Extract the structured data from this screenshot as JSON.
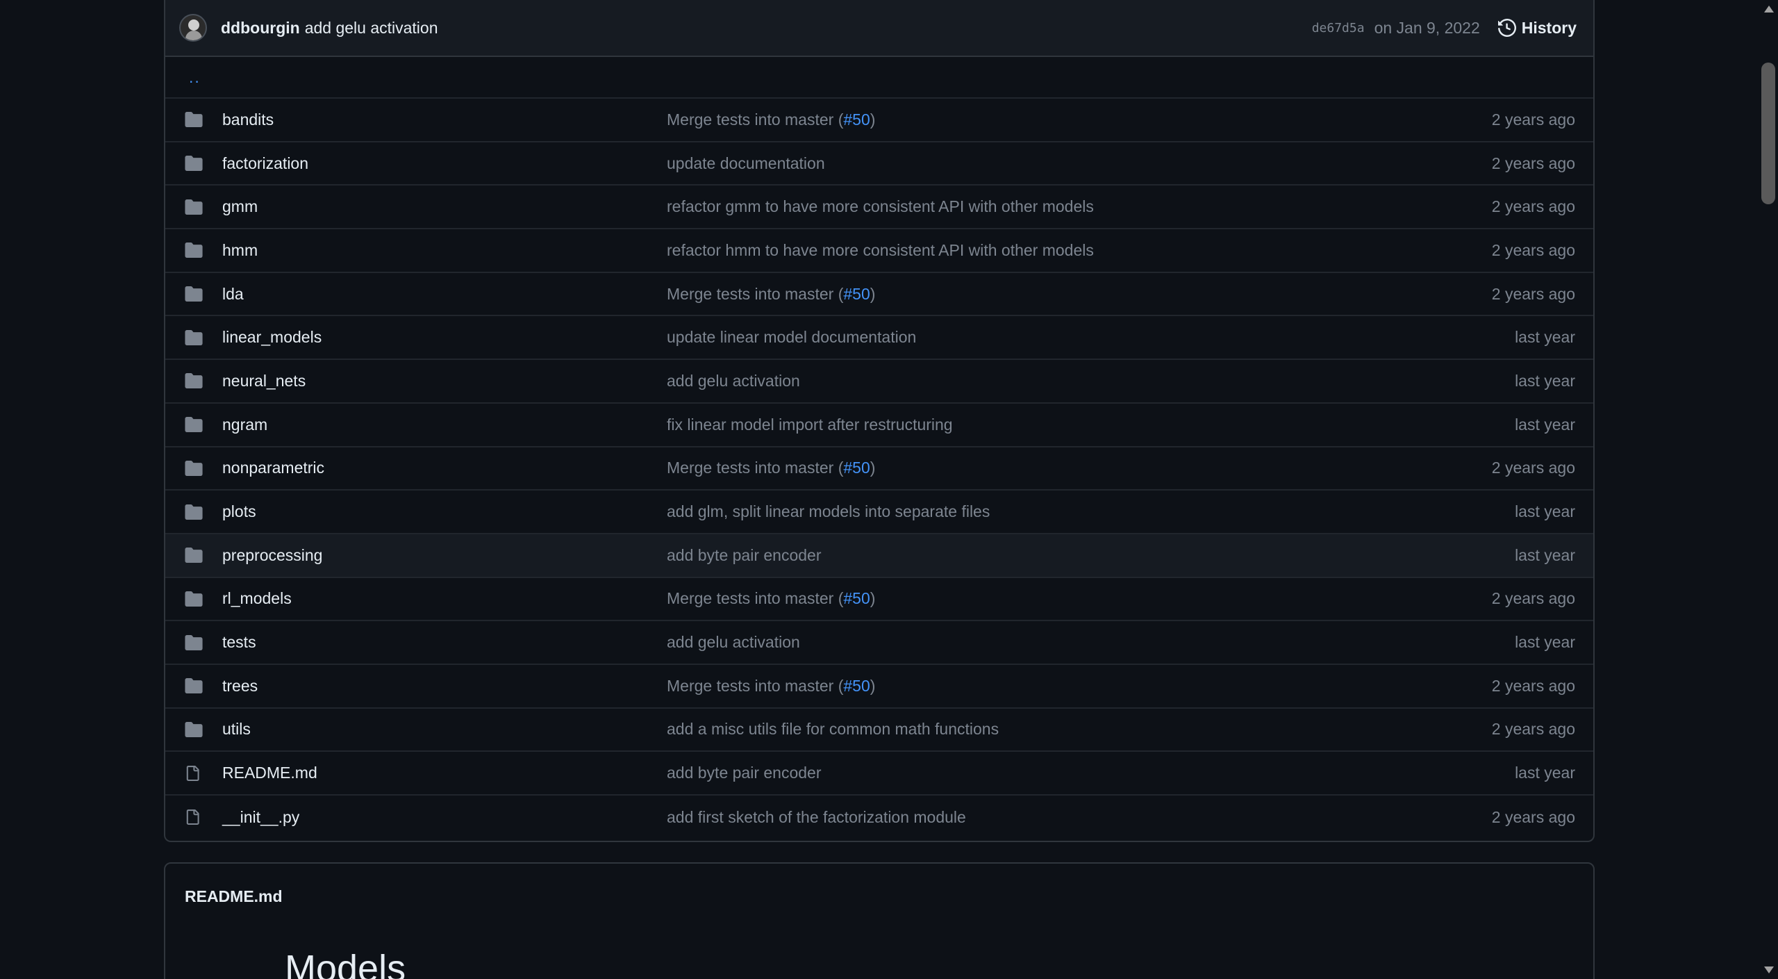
{
  "commit": {
    "author": "ddbourgin",
    "message": "add gelu activation",
    "sha": "de67d5a",
    "date": "on Jan 9, 2022",
    "history_label": "History"
  },
  "updir_label": "..",
  "files": [
    {
      "name": "bandits",
      "type": "folder",
      "message": "Merge tests into master (",
      "pr": "#50",
      "tail": ")",
      "age": "2 years ago"
    },
    {
      "name": "factorization",
      "type": "folder",
      "message": "update documentation",
      "pr": "",
      "tail": "",
      "age": "2 years ago"
    },
    {
      "name": "gmm",
      "type": "folder",
      "message": "refactor gmm to have more consistent API with other models",
      "pr": "",
      "tail": "",
      "age": "2 years ago"
    },
    {
      "name": "hmm",
      "type": "folder",
      "message": "refactor hmm to have more consistent API with other models",
      "pr": "",
      "tail": "",
      "age": "2 years ago"
    },
    {
      "name": "lda",
      "type": "folder",
      "message": "Merge tests into master (",
      "pr": "#50",
      "tail": ")",
      "age": "2 years ago"
    },
    {
      "name": "linear_models",
      "type": "folder",
      "message": "update linear model documentation",
      "pr": "",
      "tail": "",
      "age": "last year"
    },
    {
      "name": "neural_nets",
      "type": "folder",
      "message": "add gelu activation",
      "pr": "",
      "tail": "",
      "age": "last year"
    },
    {
      "name": "ngram",
      "type": "folder",
      "message": "fix linear model import after restructuring",
      "pr": "",
      "tail": "",
      "age": "last year"
    },
    {
      "name": "nonparametric",
      "type": "folder",
      "message": "Merge tests into master (",
      "pr": "#50",
      "tail": ")",
      "age": "2 years ago"
    },
    {
      "name": "plots",
      "type": "folder",
      "message": "add glm, split linear models into separate files",
      "pr": "",
      "tail": "",
      "age": "last year"
    },
    {
      "name": "preprocessing",
      "type": "folder",
      "message": "add byte pair encoder",
      "pr": "",
      "tail": "",
      "age": "last year"
    },
    {
      "name": "rl_models",
      "type": "folder",
      "message": "Merge tests into master (",
      "pr": "#50",
      "tail": ")",
      "age": "2 years ago"
    },
    {
      "name": "tests",
      "type": "folder",
      "message": "add gelu activation",
      "pr": "",
      "tail": "",
      "age": "last year"
    },
    {
      "name": "trees",
      "type": "folder",
      "message": "Merge tests into master (",
      "pr": "#50",
      "tail": ")",
      "age": "2 years ago"
    },
    {
      "name": "utils",
      "type": "folder",
      "message": "add a misc utils file for common math functions",
      "pr": "",
      "tail": "",
      "age": "2 years ago"
    },
    {
      "name": "README.md",
      "type": "file",
      "message": "add byte pair encoder",
      "pr": "",
      "tail": "",
      "age": "last year"
    },
    {
      "name": "__init__.py",
      "type": "file",
      "message": "add first sketch of the factorization module",
      "pr": "",
      "tail": "",
      "age": "2 years ago"
    }
  ],
  "highlighted_row": "preprocessing",
  "readme": {
    "title": "README.md",
    "heading": "Models"
  },
  "colors": {
    "background": "#0d1117",
    "link": "#4493f8",
    "muted": "#7d8590",
    "border": "#30363d"
  }
}
